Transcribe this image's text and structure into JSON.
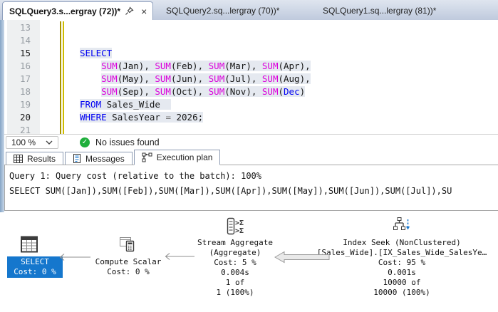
{
  "tab_bar": {
    "tabs": [
      {
        "label": "SQLQuery3.s...ergray (72))*",
        "active": true
      },
      {
        "label": "SQLQuery2.sq...lergray (70))*",
        "active": false
      },
      {
        "label": "SQLQuery1.sq...lergray (81))*",
        "active": false
      }
    ]
  },
  "editor": {
    "syntax_colors": {
      "keyword": "#0000f2",
      "function": "#dc00dc",
      "plain": "#161616",
      "operator": "#777777",
      "selection_bg": "#e5e9f0"
    },
    "lines": [
      {
        "num": "13",
        "indent": 0,
        "selected": false,
        "current": false,
        "segments": []
      },
      {
        "num": "14",
        "indent": 0,
        "selected": false,
        "current": false,
        "segments": []
      },
      {
        "num": "15",
        "indent": 0,
        "selected": true,
        "current": true,
        "segments": [
          {
            "c": "kw",
            "t": "SELECT"
          }
        ]
      },
      {
        "num": "16",
        "indent": 4,
        "selected": true,
        "current": false,
        "segments": [
          {
            "c": "fn",
            "t": "SUM"
          },
          {
            "c": "pl",
            "t": "(Jan), "
          },
          {
            "c": "fn",
            "t": "SUM"
          },
          {
            "c": "pl",
            "t": "(Feb), "
          },
          {
            "c": "fn",
            "t": "SUM"
          },
          {
            "c": "pl",
            "t": "(Mar), "
          },
          {
            "c": "fn",
            "t": "SUM"
          },
          {
            "c": "pl",
            "t": "(Apr),"
          }
        ]
      },
      {
        "num": "17",
        "indent": 4,
        "selected": true,
        "current": false,
        "segments": [
          {
            "c": "fn",
            "t": "SUM"
          },
          {
            "c": "pl",
            "t": "(May), "
          },
          {
            "c": "fn",
            "t": "SUM"
          },
          {
            "c": "pl",
            "t": "(Jun), "
          },
          {
            "c": "fn",
            "t": "SUM"
          },
          {
            "c": "pl",
            "t": "(Jul), "
          },
          {
            "c": "fn",
            "t": "SUM"
          },
          {
            "c": "pl",
            "t": "(Aug),"
          }
        ]
      },
      {
        "num": "18",
        "indent": 4,
        "selected": true,
        "current": false,
        "segments": [
          {
            "c": "fn",
            "t": "SUM"
          },
          {
            "c": "pl",
            "t": "(Sep), "
          },
          {
            "c": "fn",
            "t": "SUM"
          },
          {
            "c": "pl",
            "t": "(Oct), "
          },
          {
            "c": "fn",
            "t": "SUM"
          },
          {
            "c": "pl",
            "t": "(Nov), "
          },
          {
            "c": "fn",
            "t": "SUM"
          },
          {
            "c": "pl",
            "t": "("
          },
          {
            "c": "kw",
            "t": "Dec"
          },
          {
            "c": "pl",
            "t": ")"
          }
        ]
      },
      {
        "num": "19",
        "indent": 0,
        "selected": true,
        "current": false,
        "segments": [
          {
            "c": "kw",
            "t": "FROM"
          },
          {
            "c": "pl",
            "t": " Sales_Wide  "
          }
        ]
      },
      {
        "num": "20",
        "indent": 0,
        "selected": true,
        "current": true,
        "segments": [
          {
            "c": "kw",
            "t": "WHERE"
          },
          {
            "c": "pl",
            "t": " SalesYear "
          },
          {
            "c": "op",
            "t": "="
          },
          {
            "c": "pl",
            "t": " 2026;"
          }
        ]
      },
      {
        "num": "21",
        "indent": 0,
        "selected": false,
        "current": false,
        "segments": []
      }
    ]
  },
  "status_bar": {
    "zoom_level": "100 %",
    "message": "No issues found",
    "check_color": "#1faf3c"
  },
  "result_tabs": [
    {
      "label": "Results",
      "active": false
    },
    {
      "label": "Messages",
      "active": false
    },
    {
      "label": "Execution plan",
      "active": true
    }
  ],
  "plan": {
    "header": {
      "line1": "Query 1: Query cost (relative to the batch): 100%",
      "line2": "SELECT SUM([Jan]),SUM([Feb]),SUM([Mar]),SUM([Apr]),SUM([May]),SUM([Jun]),SUM([Jul]),SU"
    },
    "highlight_color": "#1577cd",
    "nodes": [
      {
        "name": "select",
        "highlighted": true,
        "lines": [
          "SELECT",
          "Cost: 0 %"
        ]
      },
      {
        "name": "compute-scalar",
        "highlighted": false,
        "lines": [
          "Compute Scalar",
          "Cost: 0 %"
        ]
      },
      {
        "name": "stream-aggregate",
        "highlighted": false,
        "lines": [
          "Stream Aggregate",
          "(Aggregate)",
          "Cost: 5 %",
          "0.004s",
          "1 of",
          "1 (100%)"
        ]
      },
      {
        "name": "index-seek",
        "highlighted": false,
        "lines": [
          "Index Seek (NonClustered)",
          "[Sales_Wide].[IX_Sales_Wide_SalesYe…",
          "Cost: 95 %",
          "0.001s",
          "10000 of",
          "10000 (100%)"
        ]
      }
    ]
  }
}
